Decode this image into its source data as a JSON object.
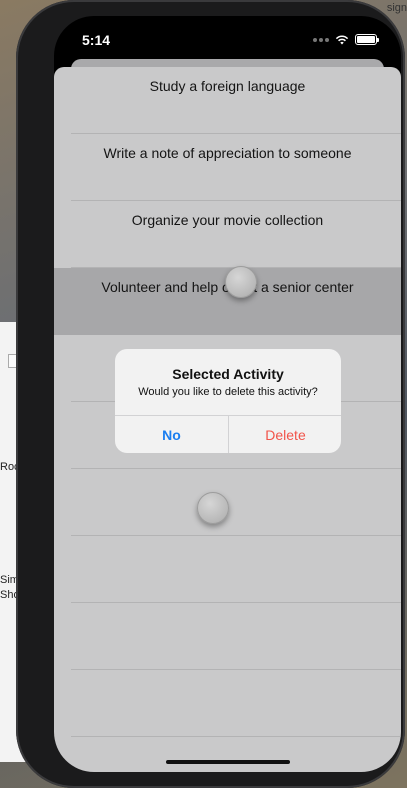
{
  "desktop": {
    "top_right_fragment": "sign",
    "left_fragments": [
      "Roc",
      "Sim",
      "Sho"
    ]
  },
  "status_bar": {
    "time": "5:14"
  },
  "activities": [
    {
      "label": "Study a foreign language",
      "selected": false
    },
    {
      "label": "Write a note of appreciation to someone",
      "selected": false
    },
    {
      "label": "Organize your movie collection",
      "selected": false
    },
    {
      "label": "Volunteer and help out at a senior center",
      "selected": true
    },
    {
      "label": "",
      "selected": false
    },
    {
      "label": "",
      "selected": false
    },
    {
      "label": "",
      "selected": false
    },
    {
      "label": "",
      "selected": false
    },
    {
      "label": "",
      "selected": false
    },
    {
      "label": "",
      "selected": false
    },
    {
      "label": "",
      "selected": false
    }
  ],
  "alert": {
    "title": "Selected Activity",
    "message": "Would you like to delete this activity?",
    "cancel_label": "No",
    "destructive_label": "Delete"
  },
  "colors": {
    "accent": "#1a7ef0",
    "destructive": "#f2544a",
    "selected_row": "#a7a7a9",
    "dimmed_background": "#c9c9ca"
  }
}
